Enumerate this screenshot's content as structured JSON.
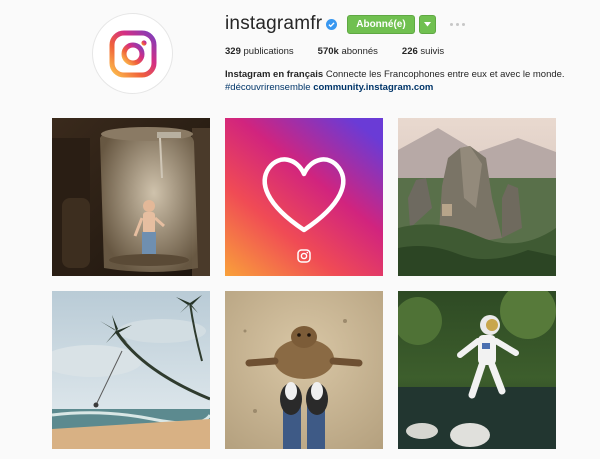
{
  "profile": {
    "username": "instagramfr",
    "follow_label": "Abonné(e)",
    "stats": {
      "posts_count": "329",
      "posts_label": "publications",
      "followers_count": "570k",
      "followers_label": "abonnés",
      "following_count": "226",
      "following_label": "suivis"
    },
    "bio": {
      "name": "Instagram en français",
      "text": "Connecte les Francophones entre eux et avec le monde.",
      "hashtag": "#découvrirensemble",
      "link": "community.instagram.com"
    }
  },
  "colors": {
    "accent_green": "#70c050",
    "verified_blue": "#3897f0",
    "link_blue": "#003569"
  },
  "icons": {
    "verified": "verified-badge-icon",
    "dropdown": "caret-down-icon",
    "more": "ellipsis-icon",
    "avatar": "instagram-logo-icon"
  }
}
